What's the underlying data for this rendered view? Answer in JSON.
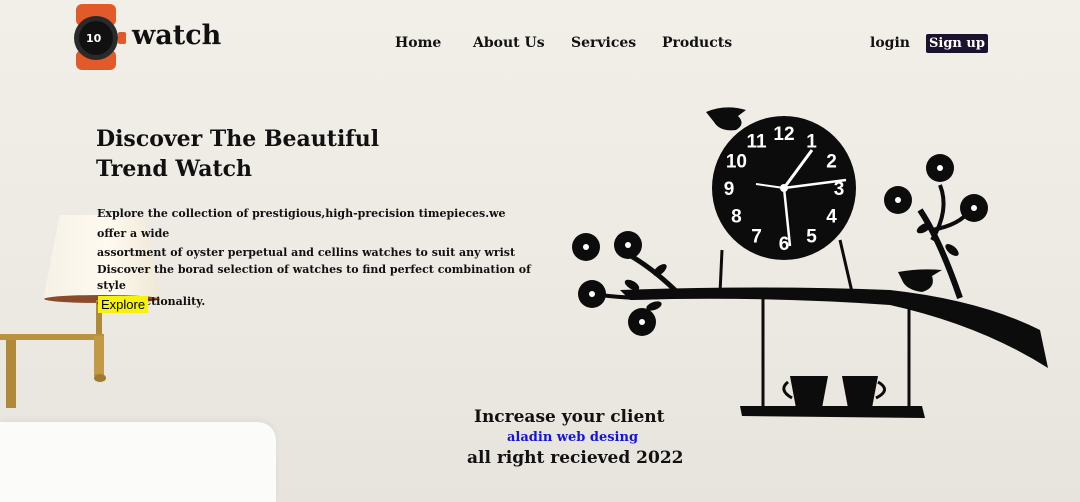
{
  "brand": {
    "name": "watch",
    "logo_icon": "smartwatch-logo-icon"
  },
  "nav": {
    "home": "Home",
    "about": "About Us",
    "services": "Services",
    "products": "Products",
    "login": "login",
    "signup": "Sign up"
  },
  "hero": {
    "title_line1": "Discover The Beautiful",
    "title_line2": "Trend Watch",
    "text_line1": "Explore the collection of prestigious,high-precision timepieces.we offer a wide",
    "text_line2": "assortment of oyster perpetual and cellins watches to suit any wrist",
    "text_line3": "Discover the borad selection of watches to find perfect combination of style",
    "text_line4": "and functionality.",
    "explore": "Explore"
  },
  "clock": {
    "numerals": [
      "12",
      "1",
      "2",
      "3",
      "4",
      "5",
      "6",
      "7",
      "8",
      "9",
      "10",
      "11"
    ]
  },
  "footer": {
    "line1": "Increase your client",
    "line2": "aladin web desing",
    "line3": "all right recieved 2022"
  },
  "colors": {
    "signup_bg": "#1b1230",
    "explore_bg": "#f6f20b",
    "footer_link": "#1515d6"
  }
}
